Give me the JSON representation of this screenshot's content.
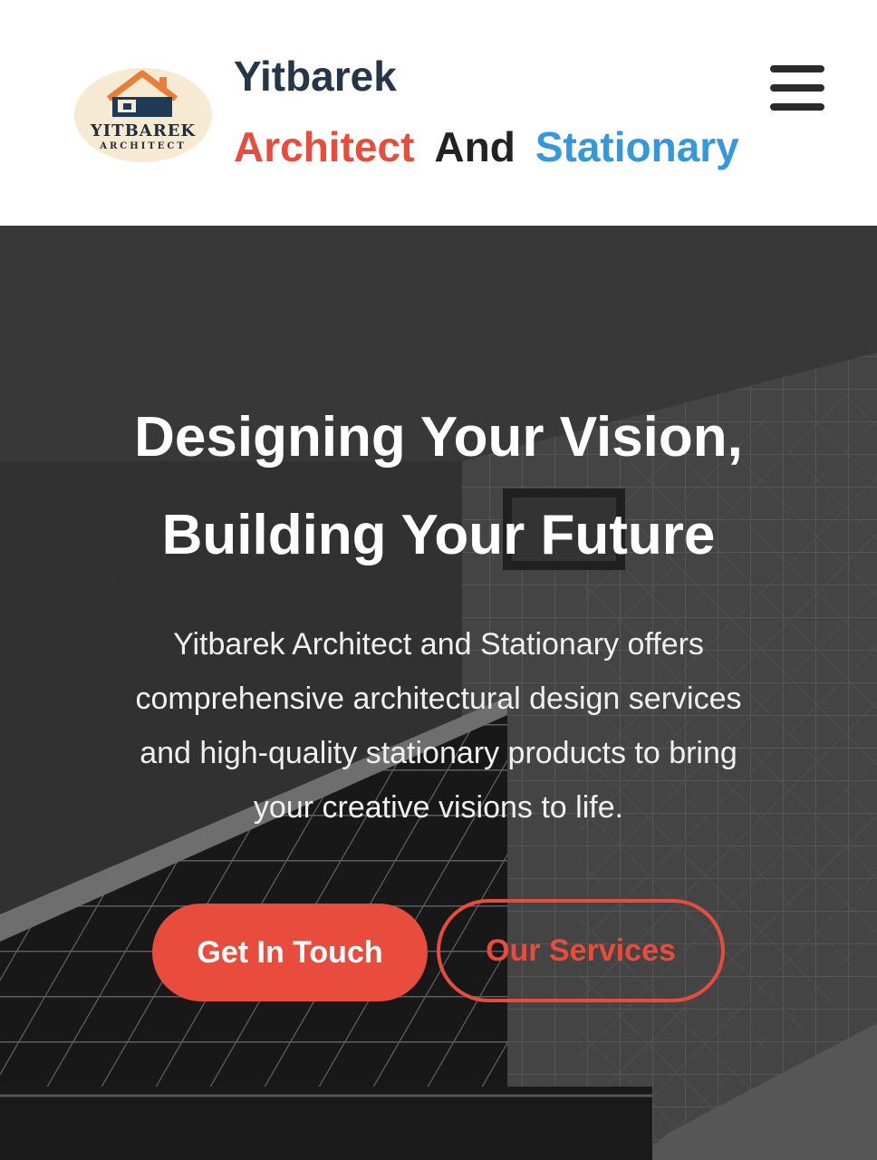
{
  "header": {
    "logo": {
      "icon": "house-logo-icon",
      "wordmark": "YITBAREK",
      "subtitle": "ARCHITECT"
    },
    "brand_name": "Yitbarek",
    "brand_tagline": {
      "word1": "Architect",
      "word2": "And",
      "word3": "Stationary"
    },
    "menu_icon": "hamburger-menu-icon"
  },
  "hero": {
    "title_line1": "Designing Your Vision,",
    "title_line2": "Building Your Future",
    "text_line1": "Yitbarek Architect and Stationary offers",
    "text_line2": "comprehensive architectural design services",
    "text_line3": "and high-quality stationary products to bring",
    "text_line4": "your creative visions to life.",
    "primary_button": "Get In Touch",
    "secondary_button": "Our Services"
  },
  "colors": {
    "accent_red": "#e74c3c",
    "accent_blue": "#3498db",
    "brand_dark": "#253649"
  }
}
